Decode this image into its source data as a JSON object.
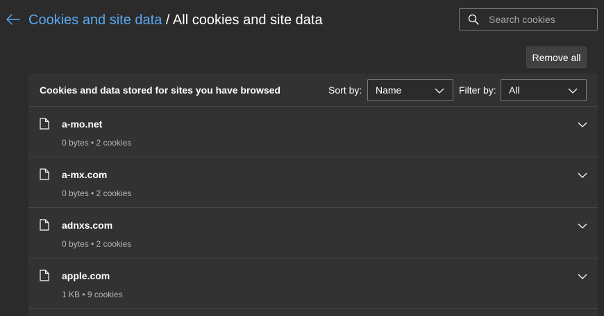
{
  "header": {
    "back_icon": "back-arrow-icon",
    "breadcrumb_parent": "Cookies and site data",
    "breadcrumb_separator": " / ",
    "breadcrumb_current": "All cookies and site data"
  },
  "search": {
    "icon": "search-icon",
    "placeholder": "Search cookies",
    "value": ""
  },
  "toolbar": {
    "remove_all_label": "Remove all"
  },
  "panel": {
    "title": "Cookies and data stored for sites you have browsed",
    "sort_label": "Sort by:",
    "sort_value": "Name",
    "filter_label": "Filter by:",
    "filter_value": "All"
  },
  "sites": [
    {
      "name": "a-mo.net",
      "size": "0 bytes",
      "cookies": "2 cookies",
      "meta": "0 bytes • 2 cookies"
    },
    {
      "name": "a-mx.com",
      "size": "0 bytes",
      "cookies": "2 cookies",
      "meta": "0 bytes • 2 cookies"
    },
    {
      "name": "adnxs.com",
      "size": "0 bytes",
      "cookies": "2 cookies",
      "meta": "0 bytes • 2 cookies"
    },
    {
      "name": "apple.com",
      "size": "1 KB",
      "cookies": "9 cookies",
      "meta": "1 KB • 9 cookies"
    }
  ],
  "colors": {
    "background": "#2b2b2b",
    "panel": "#323232",
    "link": "#5aa8f0",
    "muted_text": "#b8b8b8"
  }
}
